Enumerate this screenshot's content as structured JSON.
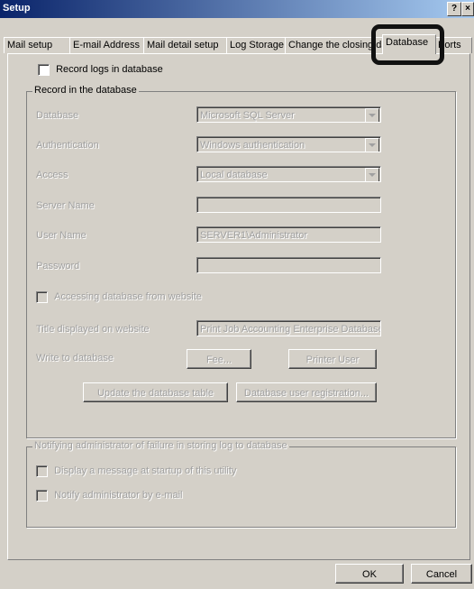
{
  "window": {
    "title": "Setup",
    "help": "?",
    "close": "×"
  },
  "tabs": [
    {
      "label": "Mail setup"
    },
    {
      "label": "E-mail Address"
    },
    {
      "label": "Mail detail setup"
    },
    {
      "label": "Log Storage"
    },
    {
      "label": "Change the closing date"
    },
    {
      "label": "Database"
    },
    {
      "label": "Ports"
    }
  ],
  "record_logs": {
    "label": "Record logs in database"
  },
  "record_group": {
    "legend": "Record in the database",
    "database": {
      "label": "Database",
      "value": "Microsoft SQL Server"
    },
    "authentication": {
      "label": "Authentication",
      "value": "Windows authentication"
    },
    "access": {
      "label": "Access",
      "value": "Local database"
    },
    "server_name": {
      "label": "Server Name",
      "value": ""
    },
    "user_name": {
      "label": "User Name",
      "value": "SERVER1\\Administrator"
    },
    "password": {
      "label": "Password",
      "value": ""
    },
    "accessing_website": {
      "label": "Accessing database from website"
    },
    "title_on_website": {
      "label": "Title displayed on website",
      "value": "Print Job Accounting Enterprise Database"
    },
    "write_to_db": {
      "label": "Write to database"
    },
    "fee_button": "Fee...",
    "printer_user_button": "Printer User",
    "update_table_button": "Update the database table",
    "db_user_reg_button": "Database user registration..."
  },
  "notify_group": {
    "legend": "Notifying administrator of failure in storing log to database",
    "display_message": {
      "label": "Display a message at startup of this utility"
    },
    "notify_email": {
      "label": "Notify administrator by e-mail"
    }
  },
  "footer": {
    "ok": "OK",
    "cancel": "Cancel"
  }
}
